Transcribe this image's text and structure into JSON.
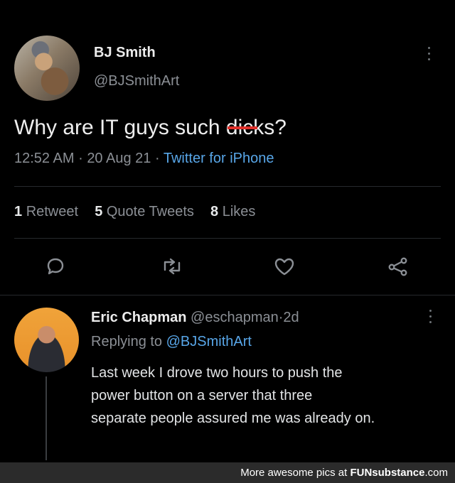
{
  "tweet": {
    "display_name": "BJ Smith",
    "handle": "@BJSmithArt",
    "text_before": "Why are IT guys such ",
    "text_censored": "dicks",
    "text_after": "?",
    "time": "12:52 AM",
    "separator": "·",
    "date": "20 Aug 21",
    "source": "Twitter for iPhone"
  },
  "stats": {
    "retweets_count": "1",
    "retweets_label": "Retweet",
    "quotes_count": "5",
    "quotes_label": "Quote Tweets",
    "likes_count": "8",
    "likes_label": "Likes"
  },
  "actions": {
    "reply": "reply-icon",
    "retweet": "retweet-icon",
    "like": "heart-icon",
    "share": "share-icon"
  },
  "reply": {
    "display_name": "Eric Chapman",
    "handle": "@eschapman",
    "separator": "·",
    "age": "2d",
    "replying_to_label": "Replying to",
    "replying_to_handle": "@BJSmithArt",
    "text_line1": "Last week I drove two hours to push the",
    "text_line2": "power button on a server that three",
    "text_line3": "separate people assured me was already on."
  },
  "footer": {
    "prefix": "More awesome pics at",
    "brand_1": "FUN",
    "brand_2": "substance",
    "brand_3": ".com"
  },
  "colors": {
    "background": "#000000",
    "link": "#58a6e8",
    "muted": "#8b8f95",
    "censor_line": "#e0302a"
  }
}
